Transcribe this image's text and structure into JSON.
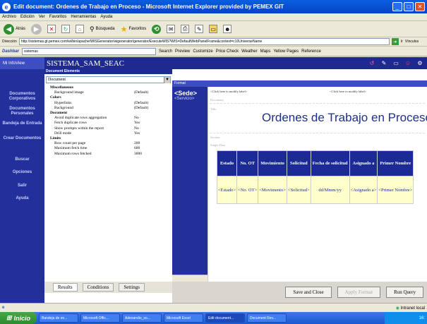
{
  "window": {
    "title": "Edit document: Ordenes de Trabajo en Proceso - Microsoft Internet Explorer provided by PEMEX GIT"
  },
  "menu": [
    "Archivo",
    "Edición",
    "Ver",
    "Favoritos",
    "Herramientas",
    "Ayuda"
  ],
  "toolbar": {
    "back": "Atrás",
    "search": "Búsqueda",
    "favorites": "Favoritos"
  },
  "address": {
    "label": "Dirección",
    "url": "http://sistemas.gt.pemex.com/wi/bin/apache/WISGenerator/wigenerator/generator/ExecuteWIS?WIS=DefaultWebPanelFrame&context=c10UniverseName",
    "go": "Ir",
    "links": "Vínculos"
  },
  "secondbar": {
    "brand": "Dashbar",
    "field": "sistemas",
    "search": "Search",
    "preview": "Preview",
    "customize": "Customize",
    "price": "Price Check",
    "weather": "Weather",
    "maps": "Maps",
    "yellow": "Yellow Pages",
    "reference": "Reference"
  },
  "app": {
    "left_label": "Mi InfoView",
    "title": "SISTEMA_SAM_SEAC"
  },
  "sidebar": [
    {
      "label": "Documentos Corporativos"
    },
    {
      "label": "Documentos Personales"
    },
    {
      "label": "Bandeja de Entrada"
    },
    {
      "label": "Crear Documentos"
    },
    {
      "label": "Buscar"
    },
    {
      "label": "Opciones"
    },
    {
      "label": "Salir"
    },
    {
      "label": "Ayuda"
    }
  ],
  "doc_elements": {
    "header": "Document Elements",
    "selected": "Document",
    "props": [
      {
        "name": "Miscellaneous",
        "value": "",
        "group": true
      },
      {
        "name": "Background image",
        "value": "(Default)"
      },
      {
        "name": "Colors",
        "value": "",
        "group": true
      },
      {
        "name": "Hyperlinks",
        "value": "(Default)"
      },
      {
        "name": "Background",
        "value": "(Default)"
      },
      {
        "name": "Document",
        "value": "",
        "group": true
      },
      {
        "name": "Avoid duplicate rows aggregation",
        "value": "No"
      },
      {
        "name": "Fetch duplicate rows",
        "value": "Yes"
      },
      {
        "name": "Show prompts within the report",
        "value": "No"
      },
      {
        "name": "Drill mode",
        "value": "Yes"
      },
      {
        "name": "Limits",
        "value": "",
        "group": true
      },
      {
        "name": "Row count per page",
        "value": "200"
      },
      {
        "name": "Maximum fetch time",
        "value": "600"
      },
      {
        "name": "Maximum rows fetched",
        "value": "3000"
      }
    ]
  },
  "tabs": [
    "Results",
    "Conditions",
    "Settings"
  ],
  "format": {
    "header": "Format",
    "sede": "<Sede>",
    "servicio": "<Servicio>",
    "click_label": "<Click here to modify label>",
    "document": "Document",
    "title": "Title",
    "report_title": "Ordenes de Trabajo en Proceso",
    "section": "Section",
    "single_data": "Single Data"
  },
  "table": {
    "headers": [
      "Estado",
      "No. OT",
      "Movimiento",
      "Solicitud",
      "Fecha de solicitud",
      "Asignado a",
      "Primer Nombre"
    ],
    "row": [
      "<Estado>",
      "<No. OT>",
      "<Movimento>",
      "<Solicitud>",
      "dd/Mmm/yy",
      "<Asignado a>",
      "<Primer Nombre>"
    ]
  },
  "buttons": {
    "save": "Save and Close",
    "apply": "Apply Format",
    "run": "Run Query"
  },
  "status": {
    "left": "",
    "zone": "Intranet local"
  },
  "taskbar": {
    "start": "Inicio",
    "items": [
      "Bandeja de en...",
      "Microsoft Offic...",
      "Adexandio_so...",
      "Microsoft Excel",
      "Edit document...",
      "Document Rev..."
    ],
    "clock": "16:"
  }
}
